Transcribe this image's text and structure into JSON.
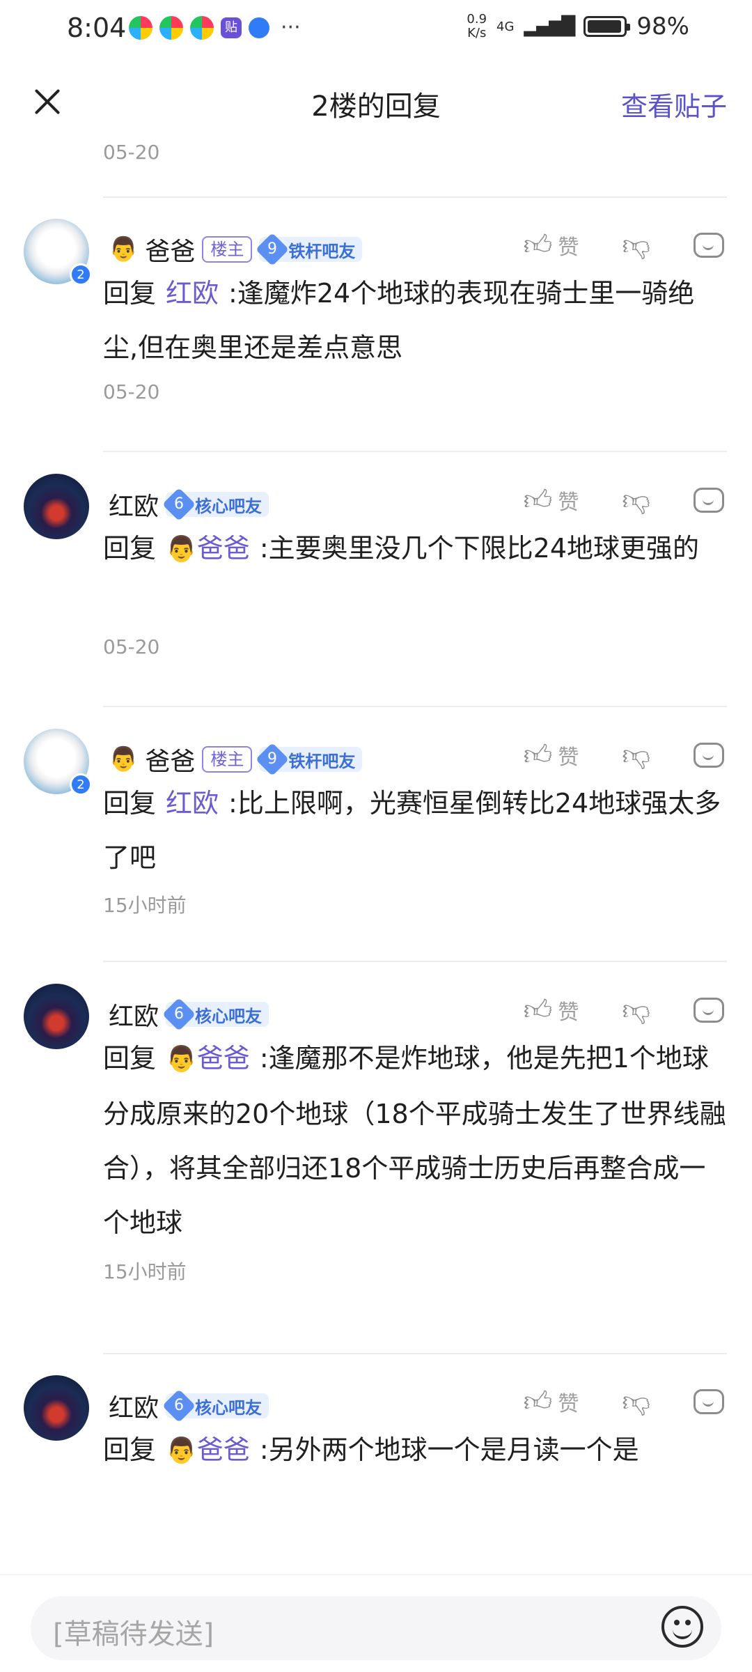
{
  "status_bar": {
    "time": "8:04",
    "more": "···",
    "net_speed_top": "0.9",
    "net_speed_bottom": "K/s",
    "signal": "4G",
    "battery": "98%"
  },
  "header": {
    "title": "2楼的回复",
    "view_post": "查看贴子"
  },
  "previous_time": "05-20",
  "common": {
    "reply_prefix": "回复",
    "like_label": "赞",
    "owner_tag": "楼主"
  },
  "replies": [
    {
      "user": "爸爸",
      "avatar": "cat",
      "avatar_level": "2",
      "emoji": "👨",
      "is_owner": true,
      "fan_level": "9",
      "fan_title": "铁杆吧友",
      "reply_to": "红欧",
      "text": ":逢魔炸24个地球的表现在骑士里一骑绝尘,但在奥里还是差点意思",
      "time": "05-20"
    },
    {
      "user": "红欧",
      "avatar": "hero",
      "emoji": "",
      "is_owner": false,
      "fan_level": "6",
      "fan_title": "核心吧友",
      "reply_to": "爸爸",
      "reply_to_emoji": "👨",
      "text": ":主要奥里没几个下限比24地球更强的",
      "time": "05-20"
    },
    {
      "user": "爸爸",
      "avatar": "cat",
      "avatar_level": "2",
      "emoji": "👨",
      "is_owner": true,
      "fan_level": "9",
      "fan_title": "铁杆吧友",
      "reply_to": "红欧",
      "text": ":比上限啊，光赛恒星倒转比24地球强太多了吧",
      "time": "15小时前"
    },
    {
      "user": "红欧",
      "avatar": "hero",
      "emoji": "",
      "is_owner": false,
      "fan_level": "6",
      "fan_title": "核心吧友",
      "reply_to": "爸爸",
      "reply_to_emoji": "👨",
      "text": ":逢魔那不是炸地球，他是先把1个地球分成原来的20个地球（18个平成骑士发生了世界线融合），将其全部归还18个平成骑士历史后再整合成一个地球",
      "time": "15小时前"
    },
    {
      "user": "红欧",
      "avatar": "hero",
      "emoji": "",
      "is_owner": false,
      "fan_level": "6",
      "fan_title": "核心吧友",
      "reply_to": "爸爸",
      "reply_to_emoji": "👨",
      "text": ":另外两个地球一个是月读一个是",
      "time": ""
    }
  ],
  "input": {
    "placeholder": "[草稿待发送]"
  }
}
